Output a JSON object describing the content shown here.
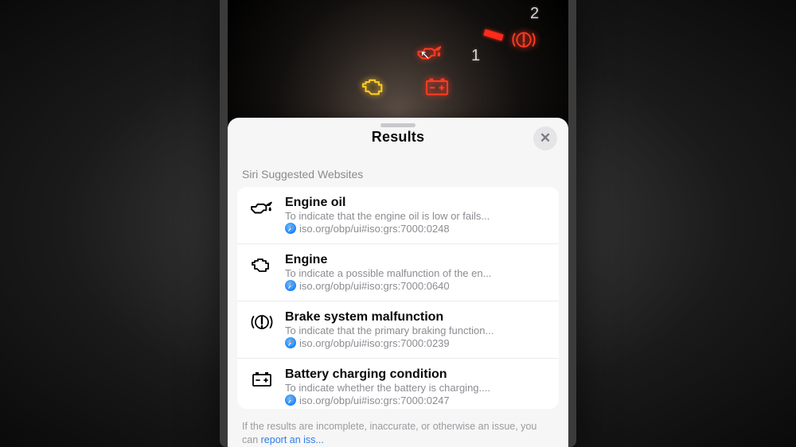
{
  "sheet": {
    "title": "Results",
    "close_aria": "Close",
    "section_label": "Siri Suggested Websites",
    "footer_prefix": "If the results are incomplete, inaccurate, or otherwise an issue, you can ",
    "footer_link": "report an iss..."
  },
  "results": [
    {
      "icon": "oil-can-icon",
      "title": "Engine oil",
      "desc": "To indicate that the engine oil is low or fails...",
      "url": "iso.org/obp/ui#iso:grs:7000:0248"
    },
    {
      "icon": "engine-icon",
      "title": "Engine",
      "desc": "To indicate a possible malfunction of the en...",
      "url": "iso.org/obp/ui#iso:grs:7000:0640"
    },
    {
      "icon": "brake-warning-icon",
      "title": "Brake system malfunction",
      "desc": "To indicate that the primary braking function...",
      "url": "iso.org/obp/ui#iso:grs:7000:0239"
    },
    {
      "icon": "battery-icon",
      "title": "Battery charging condition",
      "desc": "To indicate whether the battery is charging....",
      "url": "iso.org/obp/ui#iso:grs:7000:0247"
    }
  ],
  "dash_numbers": {
    "n1": "1",
    "n2": "2"
  }
}
